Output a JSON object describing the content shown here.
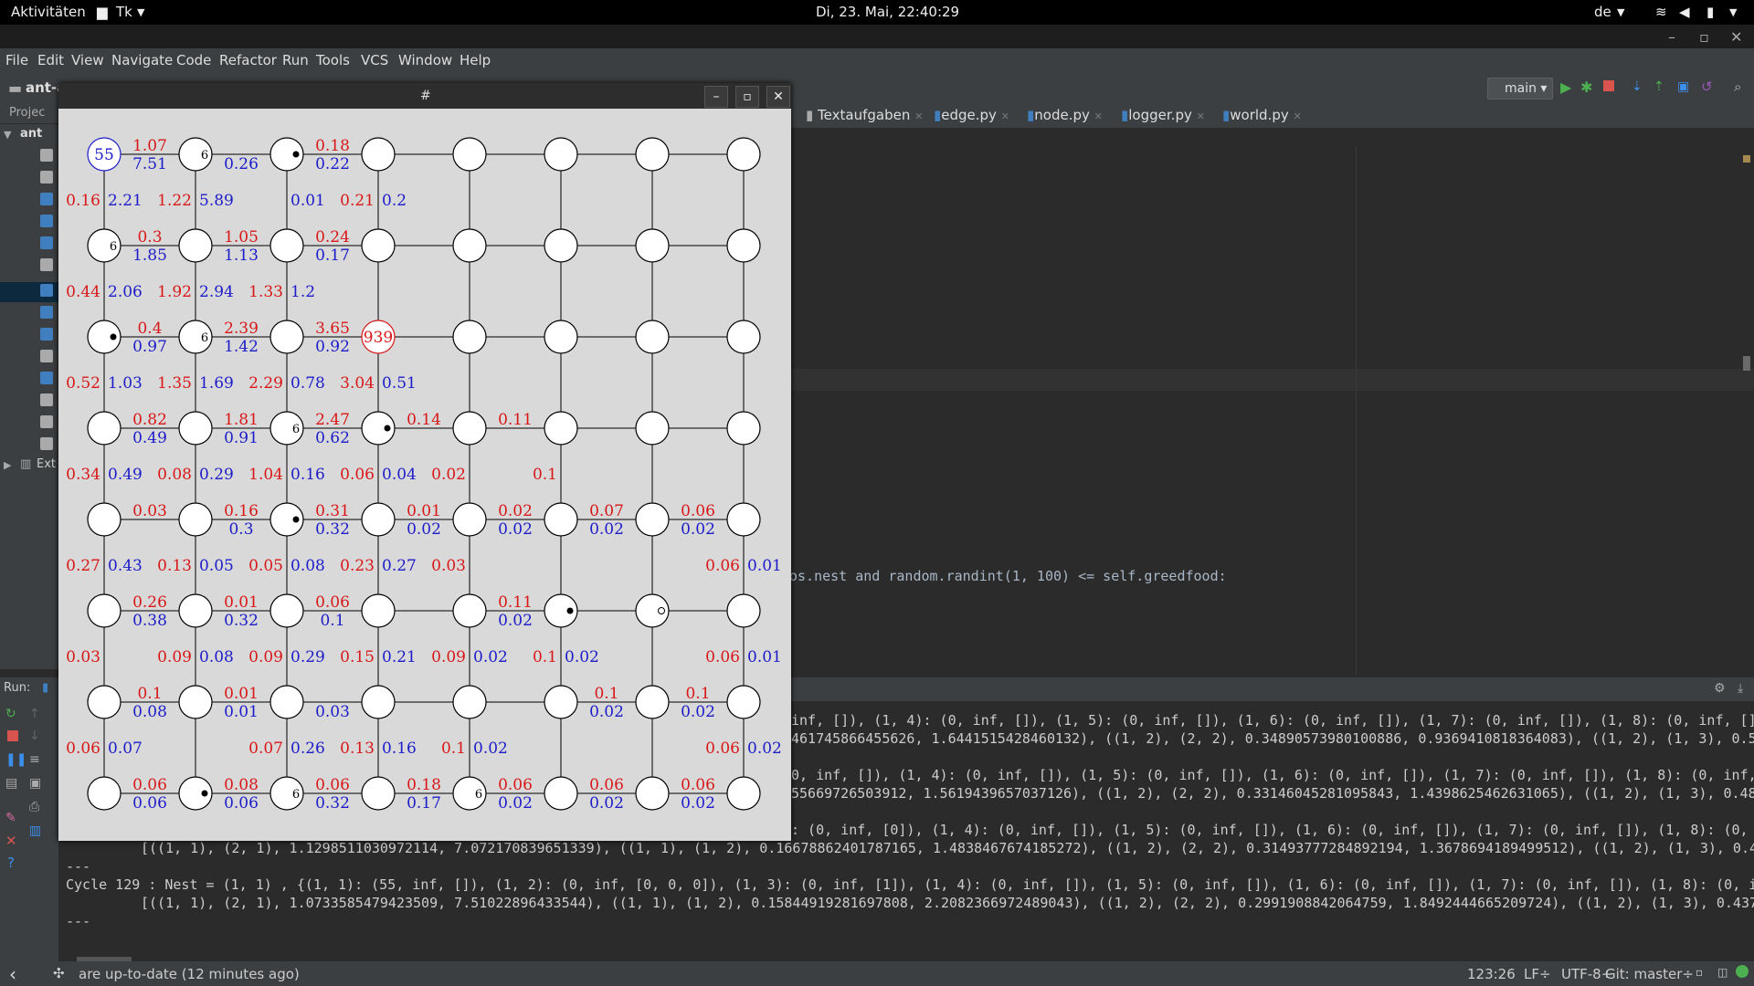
{
  "desktop": {
    "activities": "Aktivitäten",
    "app_menu": "Tk",
    "clock": "Di, 23. Mai, 22:40:29",
    "keyboard": "de"
  },
  "ide": {
    "menu": [
      "File",
      "Edit",
      "View",
      "Navigate",
      "Code",
      "Refactor",
      "Run",
      "Tools",
      "VCS",
      "Window",
      "Help"
    ],
    "project_name": "ant-a",
    "project_label": "Projec",
    "tree_root": "ant",
    "ext_label": "Ext",
    "run_config": "main",
    "tabs": [
      "Textaufgaben",
      "edge.py",
      "node.py",
      "logger.py",
      "world.py"
    ],
    "code_line": "os.nest and random.randint(1, 100) <= self.greedfood:",
    "run_label": "Run:",
    "console": [
      "inf, []), (1, 4): (0, inf, []), (1, 5): (0, inf, []), (1, 6): (0, inf, []), (1, 7): (0, inf, []), (1, 8): (0, inf, []",
      "461745866455626, 1.6441515428460132), ((1, 2), (2, 2), 0.34890573980100886, 0.9369410818364083), ((1, 2), (1, 3), 0.5",
      "0, inf, []), (1, 4): (0, inf, []), (1, 5): (0, inf, []), (1, 6): (0, inf, []), (1, 7): (0, inf, []), (1, 8): (0, inf,",
      "55669726503912, 1.5619439657037126), ((1, 2), (2, 2), 0.33146045281095843, 1.4398625462631065), ((1, 2), (1, 3), 0.48",
      ": (0, inf, [0]), (1, 4): (0, inf, []), (1, 5): (0, inf, []), (1, 6): (0, inf, []), (1, 7): (0, inf, []), (1, 8): (0, i",
      "[((1, 1), (2, 1), 1.1298511030972114, 7.072170839651339), ((1, 1), (1, 2), 0.16678862401787165, 1.4838467674185272), ((1, 2), (2, 2), 0.31493777284892194, 1.3678694189499512), ((1, 2), (1, 3), 0.46",
      "---",
      "Cycle 129 : Nest = (1, 1) , {(1, 1): (55, inf, []), (1, 2): (0, inf, [0, 0, 0]), (1, 3): (0, inf, [1]), (1, 4): (0, inf, []), (1, 5): (0, inf, []), (1, 6): (0, inf, []), (1, 7): (0, inf, []), (1, 8): (0, in",
      "[((1, 1), (2, 1), 1.0733585479423509, 7.51022896433544), ((1, 1), (1, 2), 0.15844919281697808, 2.2082366972489043), ((1, 2), (2, 2), 0.2991908842064759, 1.8492444665209724), ((1, 2), (1, 3), 0.437",
      "---"
    ],
    "status_msg": "are up-to-date (12 minutes ago)",
    "caret_pos": "123:26",
    "line_sep": "LF÷",
    "encoding": "UTF-8÷",
    "git": "Git: master÷"
  },
  "tk_window": {
    "title": "#",
    "grid": {
      "rows": 8,
      "cols": 8
    },
    "nest_label": "55",
    "food_label": "939",
    "h_edges": [
      [
        "1.07",
        "7.51"
      ],
      [
        null,
        "0.26"
      ],
      [
        "0.18",
        "0.22"
      ],
      null,
      null,
      null,
      null,
      [
        "0.3",
        "1.85"
      ],
      [
        "1.05",
        "1.13"
      ],
      [
        "0.24",
        "0.17"
      ],
      null,
      null,
      null,
      null,
      [
        "0.4",
        "0.97"
      ],
      [
        "2.39",
        "1.42"
      ],
      [
        "3.65",
        "0.92"
      ],
      null,
      null,
      null,
      null,
      [
        "0.82",
        "0.49"
      ],
      [
        "1.81",
        "0.91"
      ],
      [
        "2.47",
        "0.62"
      ],
      [
        "0.14",
        null
      ],
      [
        "0.11",
        null
      ],
      null,
      null,
      [
        "0.03",
        null
      ],
      [
        "0.16",
        "0.3"
      ],
      [
        "0.31",
        "0.32"
      ],
      [
        "0.01",
        "0.02"
      ],
      [
        "0.02",
        "0.02"
      ],
      [
        "0.07",
        "0.02"
      ],
      [
        "0.06",
        "0.02"
      ],
      [
        "0.26",
        "0.38"
      ],
      [
        "0.01",
        "0.32"
      ],
      [
        "0.06",
        "0.1"
      ],
      null,
      [
        "0.11",
        "0.02"
      ],
      null,
      null,
      [
        "0.1",
        "0.08"
      ],
      [
        "0.01",
        "0.01"
      ],
      [
        null,
        "0.03"
      ],
      null,
      null,
      [
        "0.1",
        "0.02"
      ],
      [
        "0.1",
        "0.02"
      ],
      [
        "0.06",
        "0.06"
      ],
      [
        "0.08",
        "0.06"
      ],
      [
        "0.06",
        "0.32"
      ],
      [
        "0.18",
        "0.17"
      ],
      [
        "0.06",
        "0.02"
      ],
      [
        "0.06",
        "0.02"
      ],
      [
        "0.06",
        "0.02"
      ]
    ],
    "v_edges": [
      [
        "0.16",
        "2.21"
      ],
      [
        "1.22",
        "5.89"
      ],
      [
        null,
        "0.01"
      ],
      [
        "0.21",
        "0.2"
      ],
      null,
      null,
      null,
      null,
      [
        "0.44",
        "2.06"
      ],
      [
        "1.92",
        "2.94"
      ],
      [
        "1.33",
        "1.2"
      ],
      null,
      null,
      null,
      null,
      null,
      [
        "0.52",
        "1.03"
      ],
      [
        "1.35",
        "1.69"
      ],
      [
        "2.29",
        "0.78"
      ],
      [
        "3.04",
        "0.51"
      ],
      null,
      null,
      null,
      null,
      [
        "0.34",
        "0.49"
      ],
      [
        "0.08",
        "0.29"
      ],
      [
        "1.04",
        "0.16"
      ],
      [
        "0.06",
        "0.04"
      ],
      [
        "0.02",
        null
      ],
      [
        "0.1",
        null
      ],
      null,
      null,
      [
        "0.27",
        "0.43"
      ],
      [
        "0.13",
        "0.05"
      ],
      [
        "0.05",
        "0.08"
      ],
      [
        "0.23",
        "0.27"
      ],
      [
        "0.03",
        null
      ],
      null,
      null,
      [
        "0.06",
        "0.01"
      ],
      [
        "0.03",
        null
      ],
      [
        "0.09",
        "0.08"
      ],
      [
        "0.09",
        "0.29"
      ],
      [
        "0.15",
        "0.21"
      ],
      [
        "0.09",
        "0.02"
      ],
      [
        "0.1",
        "0.02"
      ],
      null,
      [
        "0.06",
        "0.01"
      ],
      [
        "0.06",
        "0.07"
      ],
      [
        null,
        null
      ],
      [
        "0.07",
        "0.26"
      ],
      [
        "0.13",
        "0.16"
      ],
      [
        "0.1",
        "0.02"
      ],
      null,
      null,
      [
        "0.06",
        "0.02"
      ]
    ],
    "ants": [
      {
        "r": 0,
        "c": 1,
        "m": "6"
      },
      {
        "r": 0,
        "c": 2,
        "m": "dot"
      },
      {
        "r": 1,
        "c": 0,
        "m": "6"
      },
      {
        "r": 2,
        "c": 0,
        "m": "dot"
      },
      {
        "r": 2,
        "c": 1,
        "m": "6"
      },
      {
        "r": 3,
        "c": 2,
        "m": "6"
      },
      {
        "r": 3,
        "c": 3,
        "m": "dot"
      },
      {
        "r": 4,
        "c": 2,
        "m": "dot"
      },
      {
        "r": 5,
        "c": 5,
        "m": "dot"
      },
      {
        "r": 5,
        "c": 6,
        "m": "o"
      },
      {
        "r": 7,
        "c": 1,
        "m": "dot"
      },
      {
        "r": 7,
        "c": 2,
        "m": "6"
      },
      {
        "r": 7,
        "c": 4,
        "m": "6"
      }
    ],
    "colors": {
      "pheromone": "#d81818",
      "distance": "#1c1cc8",
      "nest": "#1c1cc8",
      "food": "#d81818"
    }
  }
}
